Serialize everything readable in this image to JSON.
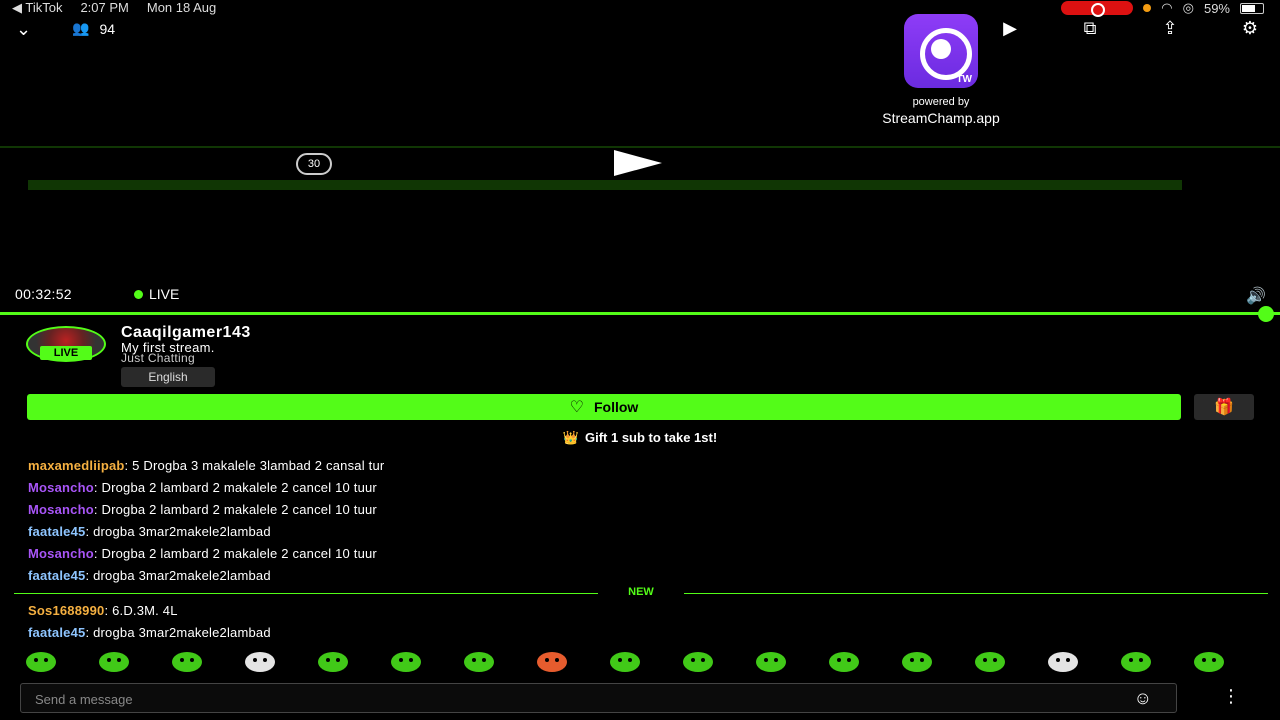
{
  "status_bar": {
    "back_app": "◀ TikTok",
    "time": "2:07 PM",
    "date": "Mon 18 Aug",
    "battery": "59%"
  },
  "top_bar": {
    "viewer_count": "94",
    "icons": [
      "chevron-down-icon",
      "viewers-icon",
      "youtube-icon",
      "cast-icon",
      "share-icon",
      "settings-icon"
    ]
  },
  "overlay_logo": {
    "badge": "TW",
    "powered_by": "powered by",
    "brand": "StreamChamp.app"
  },
  "player": {
    "replay_label": "30",
    "elapsed": "00:32:52",
    "live_label": "LIVE",
    "progress_fraction": 1.0
  },
  "channel": {
    "name": "Caaqilgamer143",
    "live_badge": "LIVE",
    "title": "My first stream.",
    "category": "Just Chatting",
    "language": "English"
  },
  "actions": {
    "follow_label": "Follow"
  },
  "gift_banner": {
    "text": "Gift 1 sub to take 1st!"
  },
  "chat": {
    "messages": [
      {
        "user": "maxamedliipab",
        "text": ": 5 Drogba 3 makalele 3lambad 2 cansal tur",
        "color": "#f5b041"
      },
      {
        "user": "Mosancho",
        "text": ": Drogba 2 lambard 2 makalele 2 cancel 10 tuur",
        "color": "#a855f7"
      },
      {
        "user": "Mosancho",
        "text": ": Drogba 2 lambard 2 makalele 2 cancel 10 tuur",
        "color": "#a855f7"
      },
      {
        "user": "faatale45",
        "text": ": drogba 3mar2makele2lambad",
        "color": "#8ec5ff"
      },
      {
        "user": "Mosancho",
        "text": ": Drogba 2 lambard 2 makalele 2 cancel 10 tuur",
        "color": "#a855f7"
      },
      {
        "user": "faatale45",
        "text": ": drogba 3mar2makele2lambad",
        "color": "#8ec5ff"
      }
    ],
    "new_divider": "NEW",
    "new_messages": [
      {
        "user": "Sos1688990",
        "text": ": 6.D.3M. 4L",
        "color": "#f5b041"
      },
      {
        "user": "faatale45",
        "text": ": drogba 3mar2makele2lambad",
        "color": "#8ec5ff"
      }
    ]
  },
  "emotes": {
    "count": 17
  },
  "composer": {
    "placeholder": "Send a message",
    "value": ""
  }
}
